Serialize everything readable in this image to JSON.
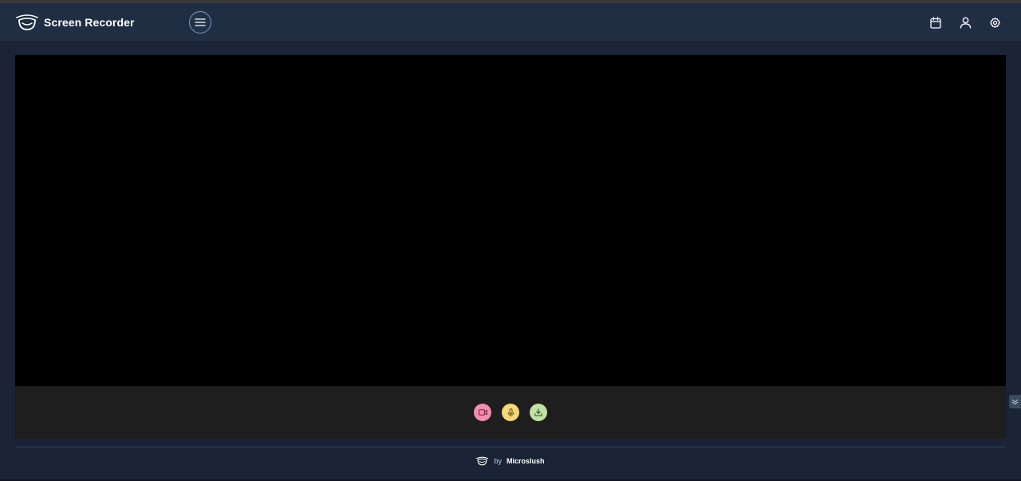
{
  "app": {
    "title": "Screen Recorder"
  },
  "header": {
    "menu_icon": "hamburger-icon",
    "actions": [
      {
        "icon": "calendar-icon"
      },
      {
        "icon": "user-icon"
      },
      {
        "icon": "gear-icon"
      }
    ]
  },
  "controls": [
    {
      "icon": "video-camera-icon",
      "color": "#f08fb0"
    },
    {
      "icon": "microphone-icon",
      "color": "#f6d879"
    },
    {
      "icon": "download-icon",
      "color": "#c2e2a4"
    }
  ],
  "footer": {
    "by_text": "by",
    "brand": "Microslush"
  },
  "colors": {
    "page_bg": "#1a2436",
    "header_bg": "#202e44",
    "stage_bg": "#000000",
    "controls_bg": "#1e1e1e"
  }
}
